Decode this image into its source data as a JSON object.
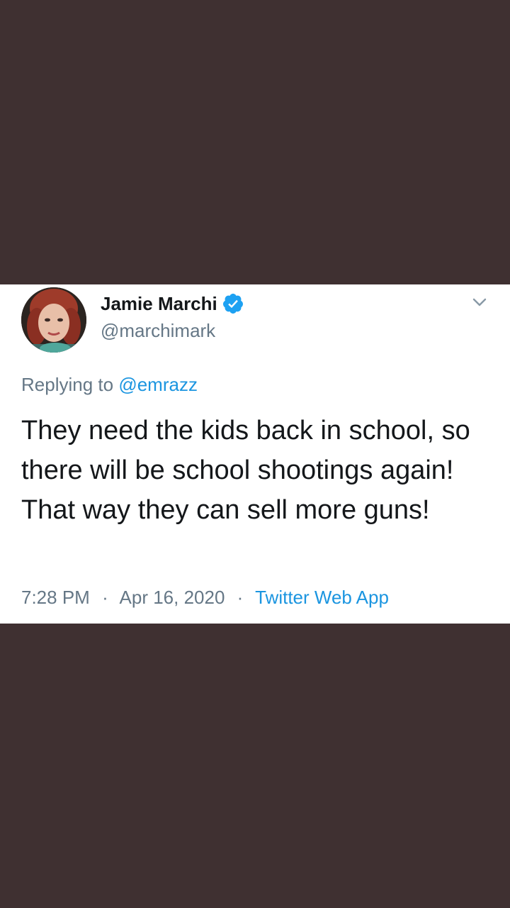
{
  "tweet": {
    "display_name": "Jamie Marchi",
    "handle": "@marchimark",
    "replying_prefix": "Replying to",
    "replying_to": "@emrazz",
    "text": "They need the kids back in school, so there will be school shootings again! That way they can sell more guns!",
    "time": "7:28 PM",
    "date": "Apr 16, 2020",
    "source": "Twitter Web App",
    "separator": "·"
  },
  "icons": {
    "verified": "verified-badge-icon",
    "menu": "chevron-down-icon"
  },
  "colors": {
    "background": "#3f3031",
    "card": "#ffffff",
    "link": "#1b95e0",
    "muted": "#657786",
    "text": "#14171a"
  }
}
